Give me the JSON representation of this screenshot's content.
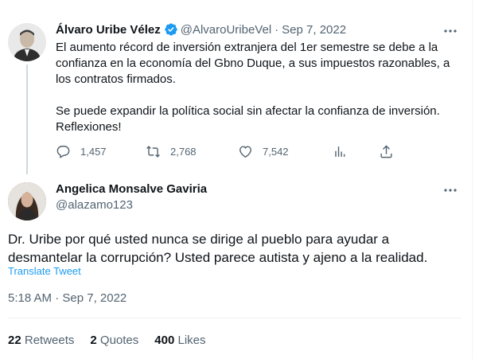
{
  "parent_tweet": {
    "name": "Álvaro Uribe Vélez",
    "handle": "@AlvaroUribeVel",
    "separator": "·",
    "date": "Sep 7, 2022",
    "paragraph1": "El aumento récord de inversión extranjera del 1er semestre se debe a la confianza en la economía del Gbno Duque, a sus impuestos razonables, a los contratos firmados.",
    "paragraph2": "Se puede expandir la política social sin afectar la confianza de inversión. Reflexiones!",
    "replies": "1,457",
    "retweets": "2,768",
    "likes": "7,542"
  },
  "reply_tweet": {
    "name": "Angelica Monsalve Gaviria",
    "handle": "@alazamo123",
    "text": "Dr. Uribe por qué usted nunca se dirige al pueblo para ayudar a desmantelar la corrupción? Usted parece autista y ajeno a la realidad.",
    "translate_label": "Translate Tweet",
    "timestamp": "5:18 AM · Sep 7, 2022",
    "stats": {
      "retweets_count": "22",
      "retweets_label": "Retweets",
      "quotes_count": "2",
      "quotes_label": "Quotes",
      "likes_count": "400",
      "likes_label": "Likes"
    }
  },
  "colors": {
    "accent": "#1d9bf0",
    "secondary_text": "#536471",
    "divider": "#eff3f4"
  },
  "icons": [
    "more-icon",
    "verified-icon",
    "reply-icon",
    "retweet-icon",
    "like-icon",
    "analytics-icon",
    "share-icon"
  ]
}
